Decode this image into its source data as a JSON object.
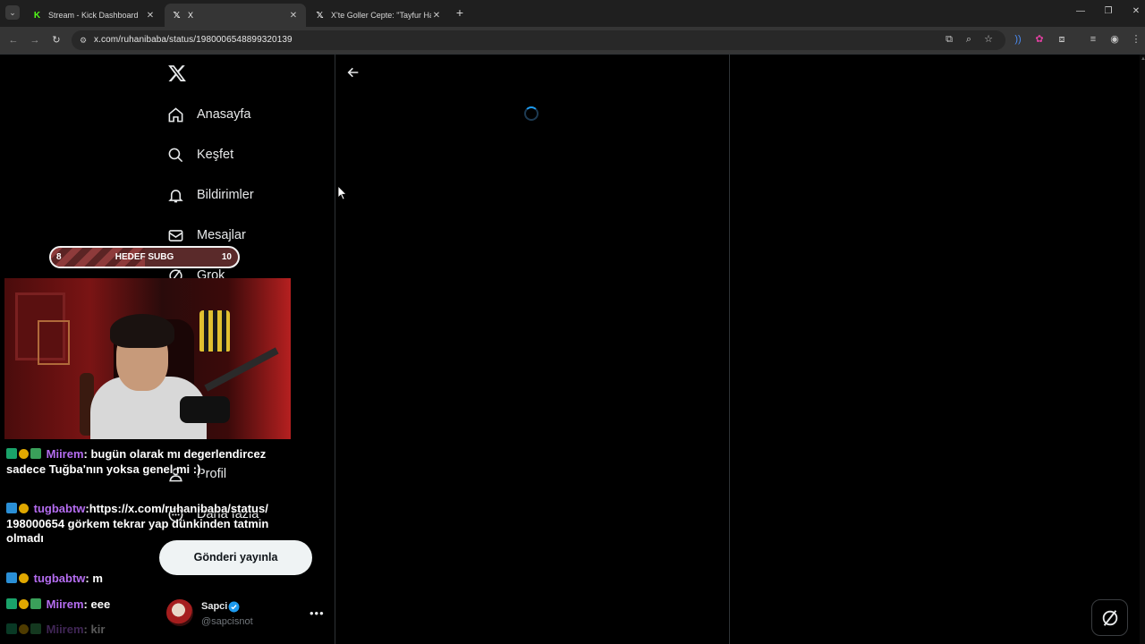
{
  "browser": {
    "tabs": [
      {
        "title": "Stream - Kick Dashboard",
        "icon": "kick-favicon",
        "active": false
      },
      {
        "title": "X",
        "icon": "x-favicon",
        "active": true
      },
      {
        "title": "X'te Goller Cepte: \"Tayfur Harik",
        "icon": "x-favicon",
        "active": false
      }
    ],
    "url": "x.com/ruhanibaba/status/1980006548899320139"
  },
  "x": {
    "nav": [
      {
        "label": "Anasayfa",
        "icon": "home-icon"
      },
      {
        "label": "Keşfet",
        "icon": "search-icon"
      },
      {
        "label": "Bildirimler",
        "icon": "bell-icon"
      },
      {
        "label": "Mesajlar",
        "icon": "mail-icon"
      },
      {
        "label": "Grok",
        "icon": "grok-icon"
      },
      {
        "label": "Profil",
        "icon": "person-icon"
      },
      {
        "label": "Daha fazla",
        "icon": "more-circle-icon"
      }
    ],
    "post_button": "Gönderi yayınla",
    "account": {
      "name": "Sapci",
      "handle": "@sapcisnot",
      "verified": true
    }
  },
  "overlay": {
    "goal": {
      "min": "8",
      "label": "HEDEF SUBG",
      "max": "10",
      "progress": 0.5
    },
    "chat": [
      {
        "user": "Miirem",
        "sep": ": ",
        "text": "bugün olarak mı degerlendircez sadece Tuğba'nın yoksa genel mi :)"
      },
      {
        "user": "tugbabtw",
        "sep": ":",
        "text": "https://x.com/ruhanibaba/status/198000654 görkem tekrar yap dünkinden tatmin olmadı"
      },
      {
        "user": "tugbabtw",
        "sep": ": ",
        "text": "m"
      },
      {
        "user": "Miirem",
        "sep": ": ",
        "text": "eee"
      },
      {
        "user": "Miirem",
        "sep": ": ",
        "text": "kir"
      }
    ]
  },
  "colors": {
    "accent": "#1d9bf0",
    "chat_user": "#b46cf0",
    "kick_green": "#53fc18"
  }
}
